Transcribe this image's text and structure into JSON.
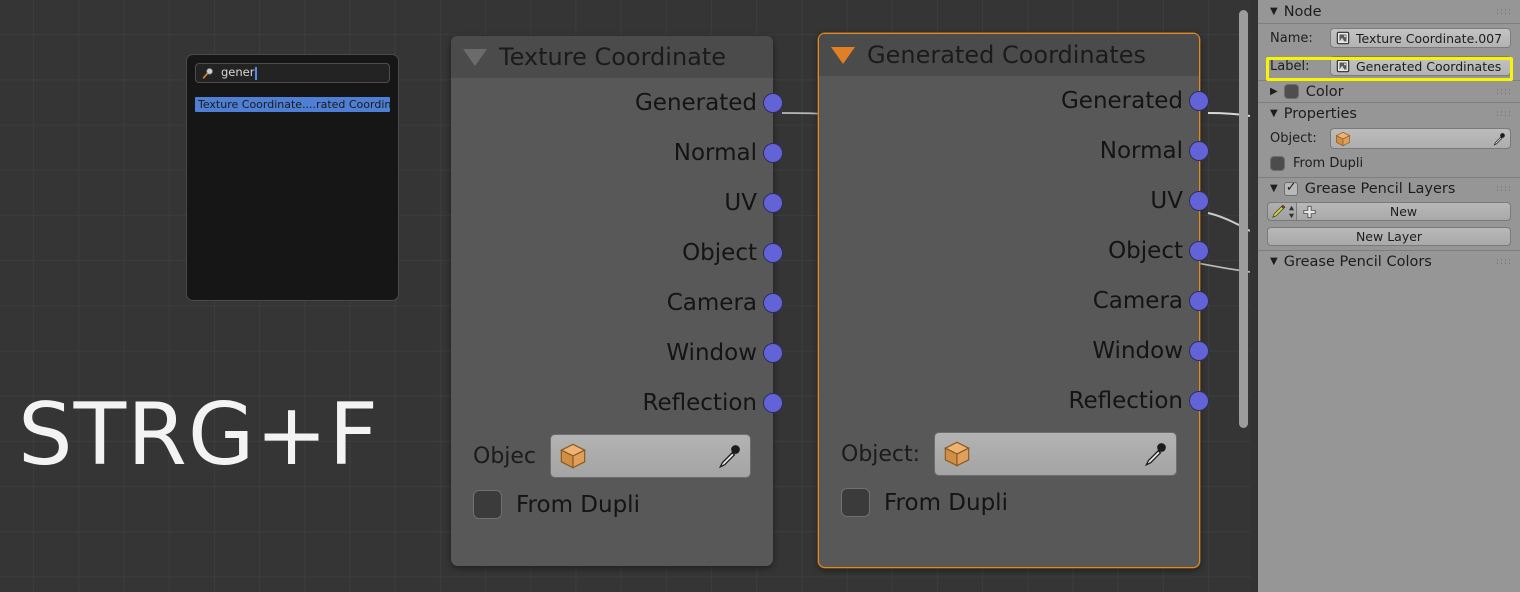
{
  "overlay": {
    "shortcut": "STRG+F"
  },
  "search_popup": {
    "icon": "magnifier-icon",
    "query": "gener",
    "results": [
      {
        "label": "Texture Coordinate....rated Coordinates)"
      }
    ]
  },
  "nodes": [
    {
      "title": "Texture Coordinate",
      "selected": false,
      "collapse_icon": "triangle-down-icon",
      "sockets": [
        "Generated",
        "Normal",
        "UV",
        "Object",
        "Camera",
        "Window",
        "Reflection"
      ],
      "object_label": "Objec",
      "object_icon": "cube-icon",
      "eyedropper_icon": "eyedropper-icon",
      "from_dupli_label": "From Dupli"
    },
    {
      "title": "Generated Coordinates",
      "selected": true,
      "collapse_icon": "triangle-down-icon",
      "sockets": [
        "Generated",
        "Normal",
        "UV",
        "Object",
        "Camera",
        "Window",
        "Reflection"
      ],
      "object_label": "Object:",
      "object_icon": "cube-icon",
      "eyedropper_icon": "eyedropper-icon",
      "from_dupli_label": "From Dupli"
    }
  ],
  "panel": {
    "node_section": {
      "title": "Node",
      "name_label": "Name:",
      "name_value": "Texture Coordinate.007",
      "label_label": "Label:",
      "label_value": "Generated Coordinates"
    },
    "color_section": {
      "title": "Color"
    },
    "properties_section": {
      "title": "Properties",
      "object_label": "Object:",
      "from_dupli_label": "From Dupli"
    },
    "grease_pencil_layers": {
      "title": "Grease Pencil Layers",
      "new_button": "New",
      "new_layer_button": "New Layer"
    },
    "grease_pencil_colors": {
      "title": "Grease Pencil Colors"
    }
  },
  "colors": {
    "selection_orange": "#e08a20",
    "highlight_yellow": "#f7f500",
    "socket_blue": "#6363d8",
    "canvas": "#353535",
    "panel_bg": "#969696"
  }
}
